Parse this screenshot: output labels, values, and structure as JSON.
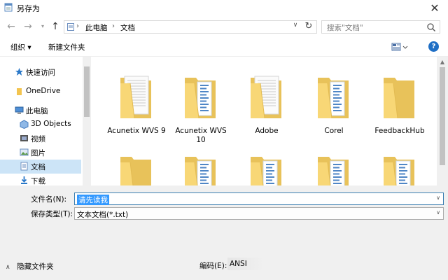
{
  "window": {
    "title": "另存为"
  },
  "nav": {
    "breadcrumb": [
      "此电脑",
      "文档"
    ],
    "search_placeholder": "搜索\"文档\""
  },
  "toolbar": {
    "organize_label": "组织 ▾",
    "new_folder_label": "新建文件夹",
    "help_label": "?"
  },
  "sidebar": {
    "items": [
      {
        "label": "快速访问",
        "icon": "star-icon",
        "selected": false
      },
      {
        "label": "OneDrive",
        "icon": "onedrive-icon",
        "selected": false
      },
      {
        "label": "此电脑",
        "icon": "computer-icon",
        "selected": false
      },
      {
        "label": "3D Objects",
        "icon": "3d-objects-icon",
        "selected": false
      },
      {
        "label": "视频",
        "icon": "video-icon",
        "selected": false
      },
      {
        "label": "图片",
        "icon": "picture-icon",
        "selected": false
      },
      {
        "label": "文档",
        "icon": "document-icon",
        "selected": true
      },
      {
        "label": "下载",
        "icon": "download-icon",
        "selected": false
      }
    ]
  },
  "files": [
    {
      "name": "Acunetix WVS 9",
      "type": "doc-folder"
    },
    {
      "name": "Acunetix WVS 10",
      "type": "blue-folder"
    },
    {
      "name": "Adobe",
      "type": "doc-folder"
    },
    {
      "name": "Corel",
      "type": "blue-folder"
    },
    {
      "name": "FeedbackHub",
      "type": "plain-folder"
    },
    {
      "name": "",
      "type": "plain-folder"
    },
    {
      "name": "",
      "type": "blue-folder"
    },
    {
      "name": "",
      "type": "blue-folder"
    },
    {
      "name": "",
      "type": "blue-folder"
    },
    {
      "name": "",
      "type": "blue-folder"
    }
  ],
  "form": {
    "filename_label": "文件名(N):",
    "filename_value": "请先读我",
    "filetype_label": "保存类型(T):",
    "filetype_value": "文本文档(*.txt)",
    "hide_folders_label": "隐藏文件夹",
    "encoding_label": "编码(E):",
    "encoding_value": "ANSI"
  },
  "colors": {
    "selection": "#cce4f7",
    "highlight": "#3399ff",
    "folder": "#f8d776",
    "help": "#1f6fc5"
  }
}
